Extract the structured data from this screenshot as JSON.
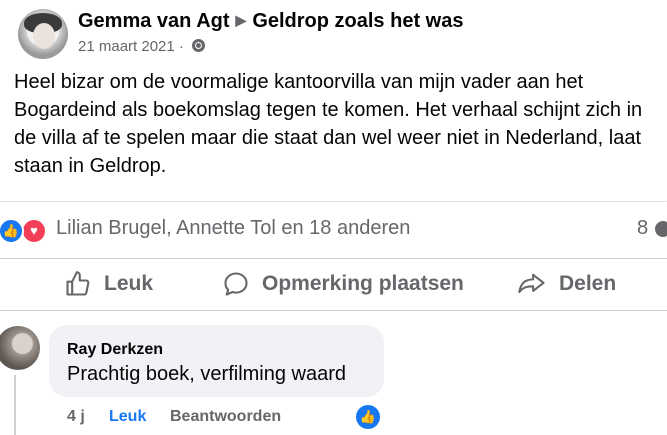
{
  "post": {
    "author": "Gemma van Agt",
    "group": "Geldrop zoals het was",
    "arrow": "▶",
    "date": "21 maart 2021",
    "date_separator": "·",
    "text": "Heel bizar om de voormalige kantoorvilla van mijn vader aan het Bogardeind als boekomslag tegen te komen. Het verhaal schijnt zich in de villa af te spelen maar die staat dan wel weer niet in Nederland, laat staan in Geldrop."
  },
  "reactions": {
    "names": "Lilian Brugel, Annette Tol en 18 anderen",
    "comment_count": "8",
    "like_glyph": "👍",
    "love_glyph": "♥"
  },
  "actions": {
    "like": "Leuk",
    "comment": "Opmerking plaatsen",
    "share": "Delen"
  },
  "comment": {
    "author": "Ray Derkzen",
    "text": "Prachtig boek, verfilming waard",
    "time": "4 j",
    "like": "Leuk",
    "reply": "Beantwoorden",
    "like_glyph": "👍"
  },
  "colors": {
    "accent": "#1877f2",
    "love": "#f33e58",
    "secondary_text": "#65676b",
    "bubble": "#f0f2f5"
  }
}
